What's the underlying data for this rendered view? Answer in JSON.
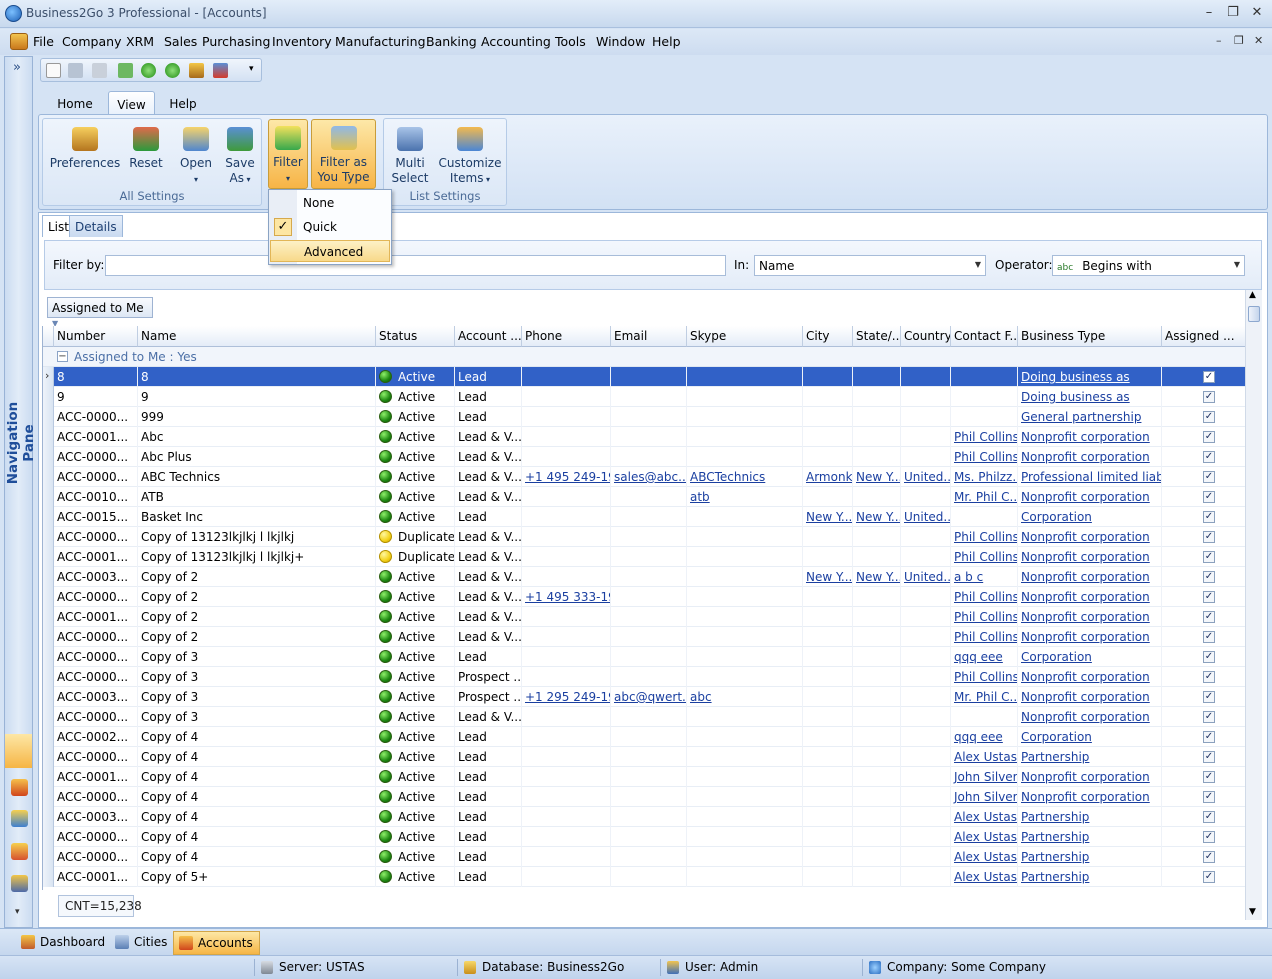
{
  "window": {
    "title": "Business2Go 3 Professional - [Accounts]"
  },
  "menu": [
    "File",
    "Company",
    "XRM",
    "Sales",
    "Purchasing",
    "Inventory",
    "Manufacturing",
    "Banking",
    "Accounting",
    "Tools",
    "Window",
    "Help"
  ],
  "nav_pane": {
    "label": "Navigation Pane",
    "expand_glyph": "»"
  },
  "ribbon": {
    "tabs": [
      "Home",
      "View",
      "Help"
    ],
    "groups": {
      "all_settings": {
        "label": "All Settings",
        "preferences": "Preferences",
        "reset": "Reset",
        "open": "Open",
        "save_as_1": "Save",
        "save_as_2": "As"
      },
      "filter": {
        "filter": "Filter",
        "fayt_1": "Filter as",
        "fayt_2": "You Type"
      },
      "list_settings": {
        "label": "List Settings",
        "multi_1": "Multi",
        "multi_2": "Select",
        "cust_1": "Customize",
        "cust_2": "Items"
      }
    }
  },
  "filter_dropdown": {
    "items": [
      "None",
      "Quick",
      "Advanced"
    ],
    "checked": "Quick",
    "highlighted": "Advanced"
  },
  "view_tabs": [
    "List",
    "Details"
  ],
  "filter_bar": {
    "filter_by_label": "Filter by:",
    "filter_value": "",
    "in_label": "In:",
    "in_value": "Name",
    "operator_label": "Operator:",
    "operator_icon": "abc",
    "operator_value": "Begins with"
  },
  "group_by": "Assigned to Me",
  "grid": {
    "columns": [
      "Number",
      "Name",
      "Status",
      "Account ...",
      "Phone",
      "Email",
      "Skype",
      "City",
      "State/...",
      "Country",
      "Contact F...",
      "Business Type",
      "Assigned ..."
    ],
    "group_label": "Assigned to Me : Yes",
    "rows": [
      {
        "number": "8",
        "name": "8",
        "status": "Active",
        "account": "Lead",
        "phone": "",
        "email": "",
        "skype": "",
        "city": "",
        "state": "",
        "country": "",
        "contact": "",
        "business": "Doing business as",
        "selected": true
      },
      {
        "number": "9",
        "name": "9",
        "status": "Active",
        "account": "Lead",
        "phone": "",
        "email": "",
        "skype": "",
        "city": "",
        "state": "",
        "country": "",
        "contact": "",
        "business": "Doing business as"
      },
      {
        "number": "ACC-0000...",
        "name": "999",
        "status": "Active",
        "account": "Lead",
        "phone": "",
        "email": "",
        "skype": "",
        "city": "",
        "state": "",
        "country": "",
        "contact": "",
        "business": "General partnership"
      },
      {
        "number": "ACC-0001...",
        "name": "Abc",
        "status": "Active",
        "account": "Lead & V...",
        "phone": "",
        "email": "",
        "skype": "",
        "city": "",
        "state": "",
        "country": "",
        "contact": "Phil Collins",
        "business": "Nonprofit corporation"
      },
      {
        "number": "ACC-0000...",
        "name": "Abc Plus",
        "status": "Active",
        "account": "Lead & V...",
        "phone": "",
        "email": "",
        "skype": "",
        "city": "",
        "state": "",
        "country": "",
        "contact": "Phil Collins",
        "business": "Nonprofit corporation"
      },
      {
        "number": "ACC-0000...",
        "name": "ABC Technics",
        "status": "Active",
        "account": "Lead & V...",
        "phone": "+1 495 249-19-7",
        "email": "sales@abc....",
        "skype": "ABCTechnics",
        "city": "Armonk",
        "state": "New Y...",
        "country": "United...",
        "contact": "Ms. Philzz...",
        "business": "Professional limited liabi..."
      },
      {
        "number": "ACC-0010...",
        "name": "ATB",
        "status": "Active",
        "account": "Lead & V...",
        "phone": "",
        "email": "",
        "skype": "atb",
        "city": "",
        "state": "",
        "country": "",
        "contact": "Mr. Phil C...",
        "business": "Nonprofit corporation"
      },
      {
        "number": "ACC-0015...",
        "name": "Basket Inc",
        "status": "Active",
        "account": "Lead",
        "phone": "",
        "email": "",
        "skype": "",
        "city": "New Y...",
        "state": "New Y...",
        "country": "United...",
        "contact": "",
        "business": "Corporation"
      },
      {
        "number": "ACC-0000...",
        "name": "Copy of 13123lkjlkj l lkjlkj",
        "status": "Duplicate",
        "account": "Lead & V...",
        "phone": "",
        "email": "",
        "skype": "",
        "city": "",
        "state": "",
        "country": "",
        "contact": "Phil Collins",
        "business": "Nonprofit corporation"
      },
      {
        "number": "ACC-0001...",
        "name": "Copy of 13123lkjlkj l lkjlkj+",
        "status": "Duplicate",
        "account": "Lead & V...",
        "phone": "",
        "email": "",
        "skype": "",
        "city": "",
        "state": "",
        "country": "",
        "contact": "Phil Collins",
        "business": "Nonprofit corporation"
      },
      {
        "number": "ACC-0003...",
        "name": "Copy of 2",
        "status": "Active",
        "account": "Lead & V...",
        "phone": "",
        "email": "",
        "skype": "",
        "city": "New Y...",
        "state": "New Y...",
        "country": "United...",
        "contact": "a b c",
        "business": "Nonprofit corporation"
      },
      {
        "number": "ACC-0000...",
        "name": "Copy of 2",
        "status": "Active",
        "account": "Lead & V...",
        "phone": "+1 495 333-19...",
        "email": "",
        "skype": "",
        "city": "",
        "state": "",
        "country": "",
        "contact": "Phil Collins",
        "business": "Nonprofit corporation"
      },
      {
        "number": "ACC-0001...",
        "name": "Copy of 2",
        "status": "Active",
        "account": "Lead & V...",
        "phone": "",
        "email": "",
        "skype": "",
        "city": "",
        "state": "",
        "country": "",
        "contact": "Phil Collins",
        "business": "Nonprofit corporation"
      },
      {
        "number": "ACC-0000...",
        "name": "Copy of 2",
        "status": "Active",
        "account": "Lead & V...",
        "phone": "",
        "email": "",
        "skype": "",
        "city": "",
        "state": "",
        "country": "",
        "contact": "Phil Collins",
        "business": "Nonprofit corporation"
      },
      {
        "number": "ACC-0000...",
        "name": "Copy of 3",
        "status": "Active",
        "account": "Lead",
        "phone": "",
        "email": "",
        "skype": "",
        "city": "",
        "state": "",
        "country": "",
        "contact": "qqq eee",
        "business": "Corporation"
      },
      {
        "number": "ACC-0000...",
        "name": "Copy of 3",
        "status": "Active",
        "account": "Prospect ...",
        "phone": "",
        "email": "",
        "skype": "",
        "city": "",
        "state": "",
        "country": "",
        "contact": "Phil Collins",
        "business": "Nonprofit corporation"
      },
      {
        "number": "ACC-0003...",
        "name": "Copy of 3",
        "status": "Active",
        "account": "Prospect ...",
        "phone": "+1 295 249-19...",
        "email": "abc@qwert...",
        "skype": "abc",
        "city": "",
        "state": "",
        "country": "",
        "contact": "Mr. Phil C...",
        "business": "Nonprofit corporation"
      },
      {
        "number": "ACC-0000...",
        "name": "Copy of 3",
        "status": "Active",
        "account": "Lead & V...",
        "phone": "",
        "email": "",
        "skype": "",
        "city": "",
        "state": "",
        "country": "",
        "contact": "",
        "business": "Nonprofit corporation"
      },
      {
        "number": "ACC-0002...",
        "name": "Copy of 4",
        "status": "Active",
        "account": "Lead",
        "phone": "",
        "email": "",
        "skype": "",
        "city": "",
        "state": "",
        "country": "",
        "contact": "qqq eee",
        "business": "Corporation"
      },
      {
        "number": "ACC-0000...",
        "name": "Copy of 4",
        "status": "Active",
        "account": "Lead",
        "phone": "",
        "email": "",
        "skype": "",
        "city": "",
        "state": "",
        "country": "",
        "contact": "Alex Ustas",
        "business": "Partnership"
      },
      {
        "number": "ACC-0001...",
        "name": "Copy of 4",
        "status": "Active",
        "account": "Lead",
        "phone": "",
        "email": "",
        "skype": "",
        "city": "",
        "state": "",
        "country": "",
        "contact": "John Silver",
        "business": "Nonprofit corporation"
      },
      {
        "number": "ACC-0000...",
        "name": "Copy of 4",
        "status": "Active",
        "account": "Lead",
        "phone": "",
        "email": "",
        "skype": "",
        "city": "",
        "state": "",
        "country": "",
        "contact": "John Silver",
        "business": "Nonprofit corporation"
      },
      {
        "number": "ACC-0003...",
        "name": "Copy of 4",
        "status": "Active",
        "account": "Lead",
        "phone": "",
        "email": "",
        "skype": "",
        "city": "",
        "state": "",
        "country": "",
        "contact": "Alex Ustas",
        "business": "Partnership"
      },
      {
        "number": "ACC-0000...",
        "name": "Copy of 4",
        "status": "Active",
        "account": "Lead",
        "phone": "",
        "email": "",
        "skype": "",
        "city": "",
        "state": "",
        "country": "",
        "contact": "Alex Ustas",
        "business": "Partnership"
      },
      {
        "number": "ACC-0000...",
        "name": "Copy of 4",
        "status": "Active",
        "account": "Lead",
        "phone": "",
        "email": "",
        "skype": "",
        "city": "",
        "state": "",
        "country": "",
        "contact": "Alex Ustas",
        "business": "Partnership"
      },
      {
        "number": "ACC-0001...",
        "name": "Copy of 5+",
        "status": "Active",
        "account": "Lead",
        "phone": "",
        "email": "",
        "skype": "",
        "city": "",
        "state": "",
        "country": "",
        "contact": "Alex Ustas",
        "business": "Partnership"
      }
    ]
  },
  "count": "CNT=15,238",
  "bottom_tabs": [
    "Dashboard",
    "Cities",
    "Accounts"
  ],
  "status_bar": {
    "server": "Server: USTAS",
    "database": "Database: Business2Go",
    "user": "User: Admin",
    "company": "Company: Some Company"
  },
  "colors": {
    "selection": "#3161c7",
    "active_status": "#1f8a12",
    "duplicate_status": "#f3d21a",
    "highlight": "#f7b446"
  }
}
